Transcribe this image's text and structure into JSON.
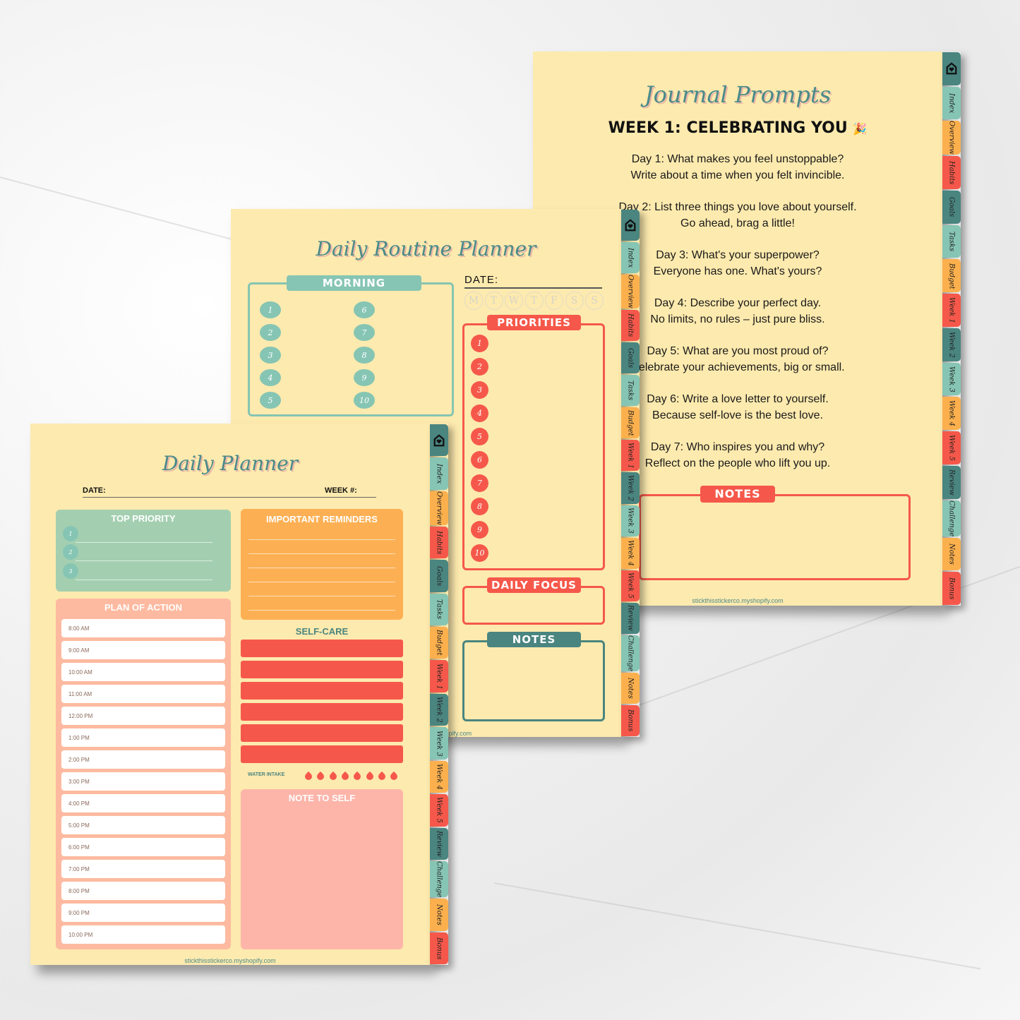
{
  "colors": {
    "teal_light": "#86c5b3",
    "orange": "#fbb04d",
    "red": "#f5584a",
    "teal_dark": "#4a8580",
    "paper": "#fdeaae"
  },
  "tabs": [
    {
      "label": "",
      "icon": "home-heart-icon",
      "color": "#4a8580"
    },
    {
      "label": "Index",
      "color": "#86c5b3"
    },
    {
      "label": "Overview",
      "color": "#fbb04d"
    },
    {
      "label": "Habits",
      "color": "#f5584a"
    },
    {
      "label": "Goals",
      "color": "#4a8580"
    },
    {
      "label": "Tasks",
      "color": "#86c5b3"
    },
    {
      "label": "Budget",
      "color": "#fbb04d"
    },
    {
      "label": "Week 1",
      "color": "#f5584a"
    },
    {
      "label": "Week 2",
      "color": "#4a8580"
    },
    {
      "label": "Week 3",
      "color": "#86c5b3"
    },
    {
      "label": "Week 4",
      "color": "#fbb04d"
    },
    {
      "label": "Week 5",
      "color": "#f5584a"
    },
    {
      "label": "Review",
      "color": "#4a8580"
    },
    {
      "label": "Challenge",
      "color": "#86c5b3"
    },
    {
      "label": "Notes",
      "color": "#fbb04d"
    },
    {
      "label": "Bonus",
      "color": "#f5584a"
    }
  ],
  "journal": {
    "title": "Journal Prompts",
    "heading": "WEEK 1: CELEBRATING YOU",
    "heading_emoji": "🎉",
    "prompts": [
      [
        "Day 1: What makes you feel unstoppable?",
        "Write about a time when you felt invincible."
      ],
      [
        "Day 2: List three things you love about yourself.",
        "Go ahead, brag a little!"
      ],
      [
        "Day 3: What's your superpower?",
        "Everyone has one. What's yours?"
      ],
      [
        "Day 4: Describe your perfect day.",
        "No limits, no rules – just pure bliss."
      ],
      [
        "Day 5: What are you most proud of?",
        "Celebrate your achievements, big or small."
      ],
      [
        "Day 6: Write a love letter to yourself.",
        "Because self-love is the best love."
      ],
      [
        "Day 7: Who inspires you and why?",
        "Reflect on the people who lift you up."
      ]
    ],
    "notes_label": "NOTES",
    "footer": "stickthisstickerco.myshopify.com"
  },
  "routine": {
    "title": "Daily Routine Planner",
    "morning_label": "MORNING",
    "morning_numbers": [
      "1",
      "2",
      "3",
      "4",
      "5",
      "6",
      "7",
      "8",
      "9",
      "10"
    ],
    "date_label": "DATE:",
    "weekdays": [
      "M",
      "T",
      "W",
      "T",
      "F",
      "S",
      "S"
    ],
    "priorities_label": "PRIORITIES",
    "priority_numbers": [
      "1",
      "2",
      "3",
      "4",
      "5",
      "6",
      "7",
      "8",
      "9",
      "10"
    ],
    "daily_focus_label": "DAILY FOCUS",
    "notes_label": "NOTES",
    "footer": "stickthisstickerco.myshopify.com"
  },
  "daily": {
    "title": "Daily Planner",
    "date_label": "DATE:",
    "week_label": "WEEK #:",
    "top_priority_label": "TOP PRIORITY",
    "top_priority_numbers": [
      "1",
      "2",
      "3"
    ],
    "reminders_label": "IMPORTANT REMINDERS",
    "plan_label": "PLAN OF ACTION",
    "times": [
      "8:00 AM",
      "9:00 AM",
      "10:00 AM",
      "11:00 AM",
      "12:00 PM",
      "1:00 PM",
      "2:00 PM",
      "3:00 PM",
      "4:00 PM",
      "5:00 PM",
      "6:00 PM",
      "7:00 PM",
      "8:00 PM",
      "9:00 PM",
      "10:00 PM"
    ],
    "self_care_label": "SELF-CARE",
    "water_label": "WATER INTAKE",
    "water_drops": 8,
    "note_to_self_label": "NOTE TO SELF",
    "footer": "stickthisstickerco.myshopify.com"
  }
}
